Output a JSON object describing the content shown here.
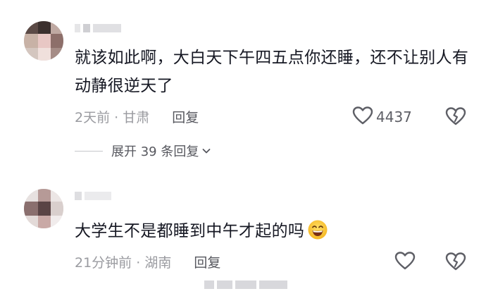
{
  "comments": [
    {
      "text": "就该如此啊，大白天下午四五点你还睡，还不让别人有动静很逆天了",
      "time": "2天前",
      "location": "甘肃",
      "reply_label": "回复",
      "like_count": "4437",
      "expand_label": "展开 39 条回复"
    },
    {
      "text": "大学生不是都睡到中午才起的吗",
      "time": "21分钟前",
      "location": "湖南",
      "reply_label": "回复"
    }
  ],
  "meta_separator": "·",
  "icons": {
    "like": "heart-outline-icon",
    "dislike": "broken-heart-icon",
    "expand": "chevron-down-icon",
    "emoji": "grinning-face-emoji"
  },
  "colors": {
    "text": "#161823",
    "meta": "#9a9ba0",
    "reply": "#56575e",
    "icon": "#5e5f66"
  }
}
